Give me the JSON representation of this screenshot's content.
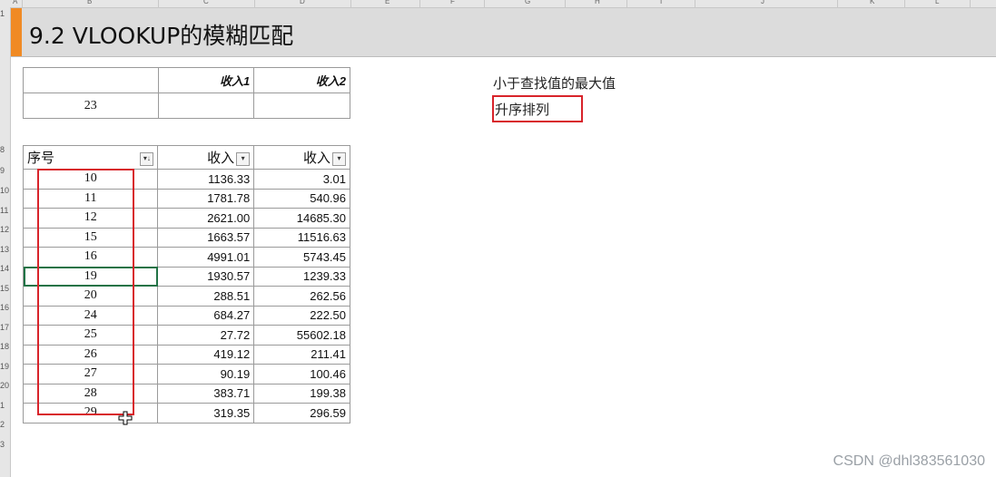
{
  "columns": [
    "A",
    "B",
    "C",
    "D",
    "E",
    "F",
    "G",
    "H",
    "I",
    "J",
    "K",
    "L"
  ],
  "row_numbers": [
    "1",
    "",
    "",
    "",
    "",
    "",
    "",
    "8",
    "9",
    "10",
    "11",
    "12",
    "13",
    "14",
    "15",
    "16",
    "17",
    "18",
    "19",
    "20",
    "1",
    "2",
    "3"
  ],
  "title": "9.2 VLOOKUP的模糊匹配",
  "lookup_table": {
    "header": [
      "",
      "收入1",
      "收入2"
    ],
    "row": [
      "23",
      "",
      ""
    ]
  },
  "data_table": {
    "header": [
      "序号",
      "收入",
      "收入"
    ],
    "rows": [
      [
        "10",
        "1136.33",
        "3.01"
      ],
      [
        "11",
        "1781.78",
        "540.96"
      ],
      [
        "12",
        "2621.00",
        "14685.30"
      ],
      [
        "15",
        "1663.57",
        "11516.63"
      ],
      [
        "16",
        "4991.01",
        "5743.45"
      ],
      [
        "19",
        "1930.57",
        "1239.33"
      ],
      [
        "20",
        "288.51",
        "262.56"
      ],
      [
        "24",
        "684.27",
        "222.50"
      ],
      [
        "25",
        "27.72",
        "55602.18"
      ],
      [
        "26",
        "419.12",
        "211.41"
      ],
      [
        "27",
        "90.19",
        "100.46"
      ],
      [
        "28",
        "383.71",
        "199.38"
      ],
      [
        "29",
        "319.35",
        "296.59"
      ]
    ]
  },
  "notes": {
    "line1": "小于查找值的最大值",
    "line2": "升序排列"
  },
  "watermark": "CSDN @dhl383561030",
  "colors": {
    "accent": "#f08a24",
    "highlight": "#d8232a",
    "selection": "#217346"
  }
}
